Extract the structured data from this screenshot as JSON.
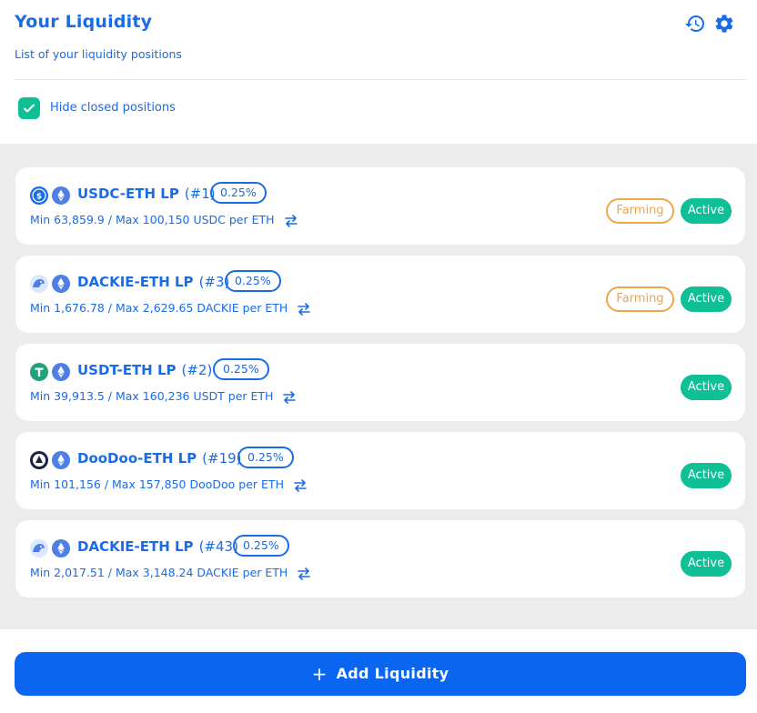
{
  "header": {
    "title": "Your Liquidity",
    "subtitle": "List of your liquidity positions"
  },
  "filter": {
    "hide_closed_label": "Hide closed positions",
    "hide_closed_checked": true
  },
  "positions": [
    {
      "pair": "USDC-ETH LP",
      "id": "(#1)",
      "fee": "0.25%",
      "range": "Min 63,859.9 / Max 100,150 USDC per ETH",
      "token_a_icon": "usdc-icon",
      "token_b_icon": "eth-icon",
      "farming": "Farming",
      "status": "Active"
    },
    {
      "pair": "DACKIE-ETH LP",
      "id": "(#3)",
      "fee": "0.25%",
      "range": "Min 1,676.78 / Max 2,629.65 DACKIE per ETH",
      "token_a_icon": "dackie-icon",
      "token_b_icon": "eth-icon",
      "farming": "Farming",
      "status": "Active"
    },
    {
      "pair": "USDT-ETH LP",
      "id": "(#2)",
      "fee": "0.25%",
      "range": "Min 39,913.5 / Max 160,236 USDT per ETH",
      "token_a_icon": "usdt-icon",
      "token_b_icon": "eth-icon",
      "status": "Active"
    },
    {
      "pair": "DooDoo-ETH LP",
      "id": "(#19)",
      "fee": "0.25%",
      "range": "Min 101,156 / Max 157,850 DooDoo per ETH",
      "token_a_icon": "doodoo-icon",
      "token_b_icon": "eth-icon",
      "status": "Active"
    },
    {
      "pair": "DACKIE-ETH LP",
      "id": "(#43)",
      "fee": "0.25%",
      "range": "Min 2,017.51 / Max 3,148.24 DACKIE per ETH",
      "token_a_icon": "dackie-icon",
      "token_b_icon": "eth-icon",
      "status": "Active"
    }
  ],
  "footer": {
    "add_label": "Add Liquidity"
  },
  "colors": {
    "primary": "#1a6be6",
    "button": "#0a66f0",
    "active": "#0fbf95",
    "farming": "#f0a54a",
    "list_bg": "#ececec"
  }
}
